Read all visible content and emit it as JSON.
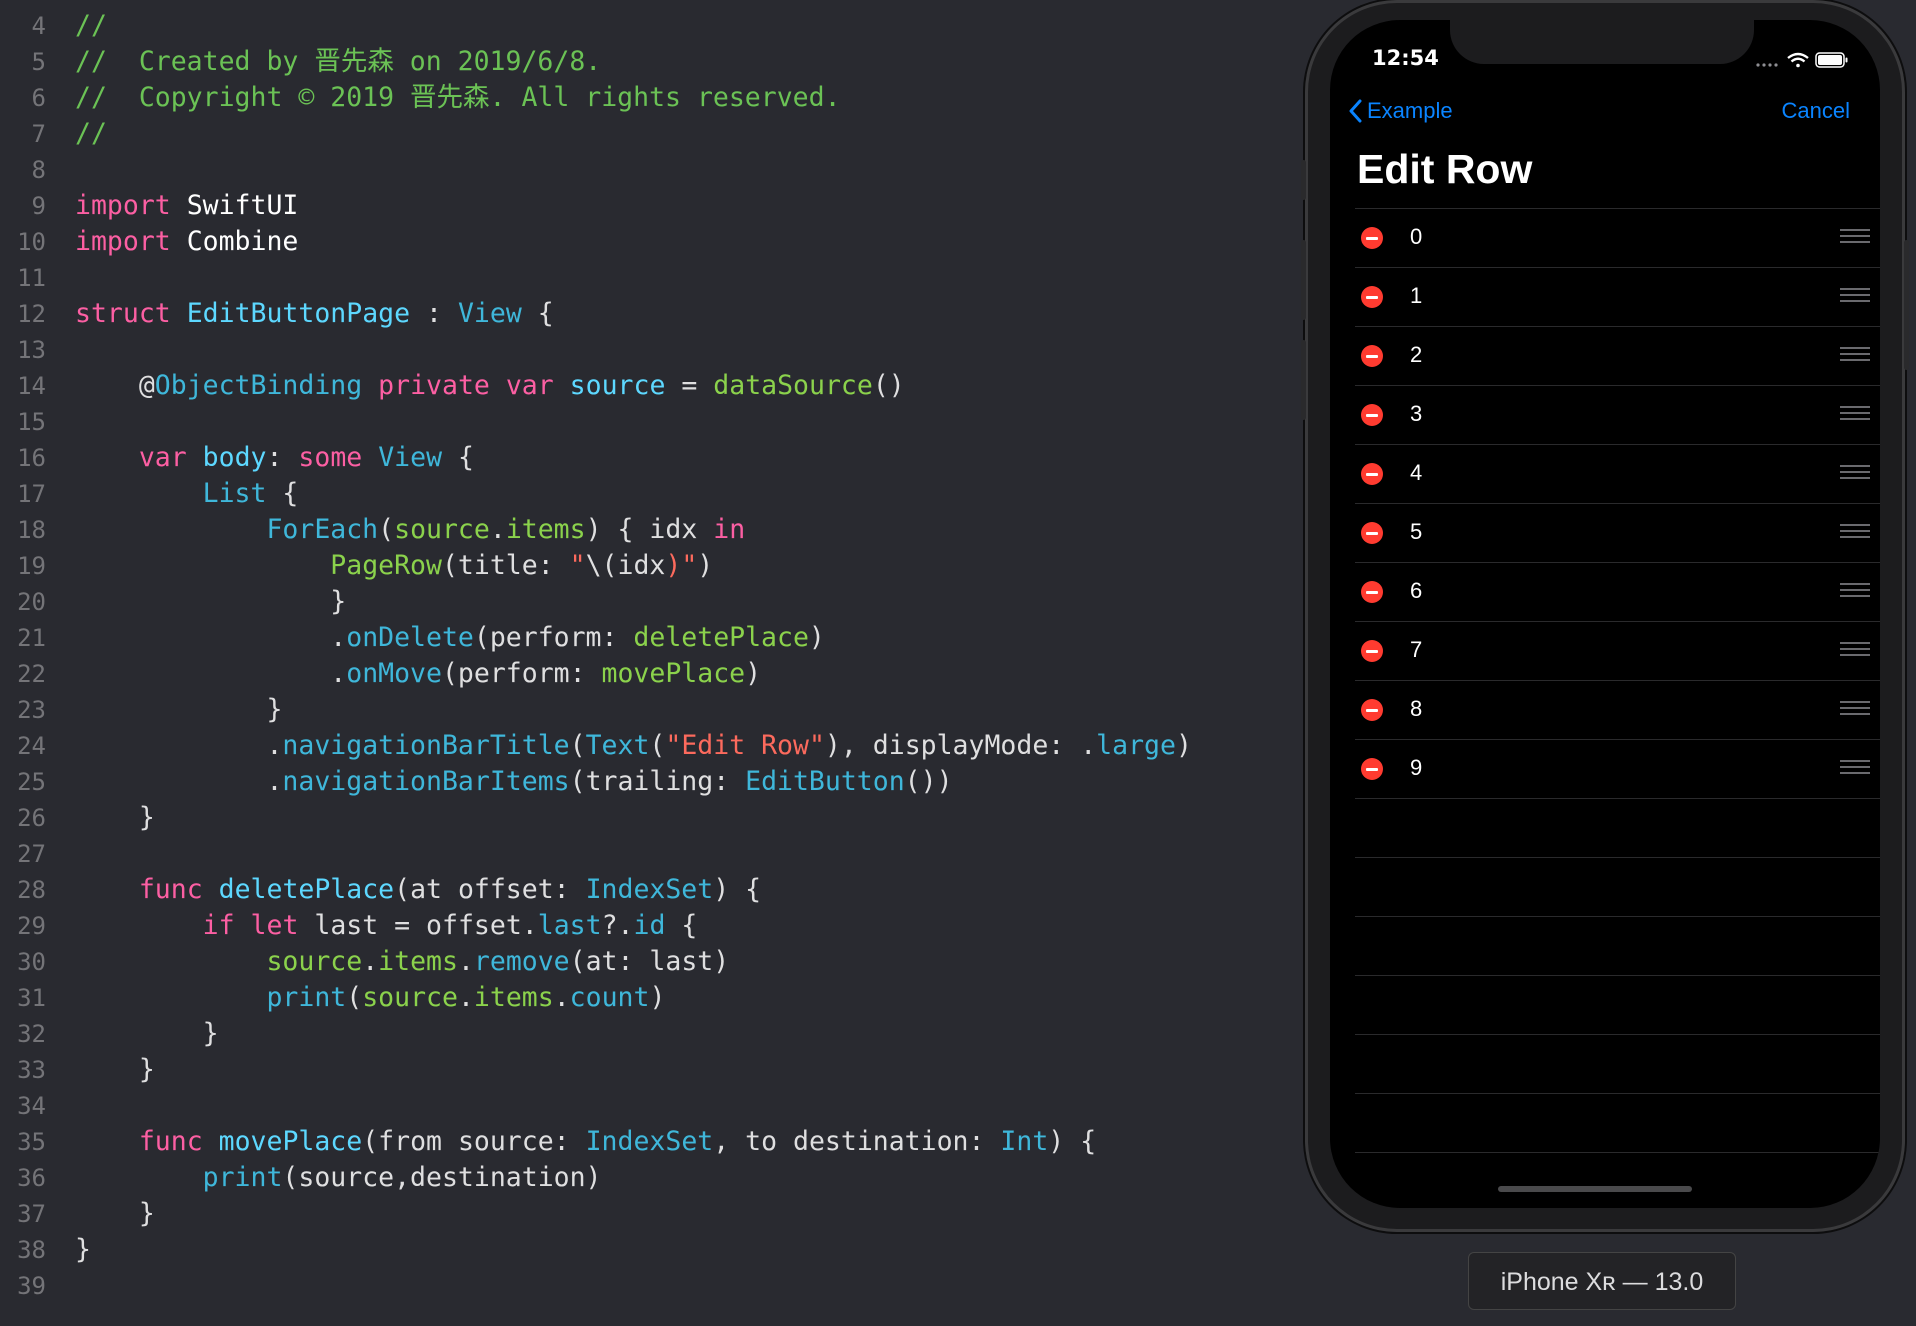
{
  "editor": {
    "lines": [
      {
        "n": "4",
        "tokens": [
          {
            "t": "//",
            "c": "t-comment"
          }
        ]
      },
      {
        "n": "5",
        "tokens": [
          {
            "t": "//  Created by 晋先森 on 2019/6/8.",
            "c": "t-comment"
          }
        ]
      },
      {
        "n": "6",
        "tokens": [
          {
            "t": "//  Copyright © 2019 晋先森. All rights reserved.",
            "c": "t-comment"
          }
        ]
      },
      {
        "n": "7",
        "tokens": [
          {
            "t": "//",
            "c": "t-comment"
          }
        ]
      },
      {
        "n": "8",
        "tokens": []
      },
      {
        "n": "9",
        "tokens": [
          {
            "t": "import",
            "c": "t-kw"
          },
          {
            "t": " SwiftUI",
            "c": "t-plain"
          }
        ]
      },
      {
        "n": "10",
        "tokens": [
          {
            "t": "import",
            "c": "t-kw"
          },
          {
            "t": " Combine",
            "c": "t-plain"
          }
        ]
      },
      {
        "n": "11",
        "tokens": []
      },
      {
        "n": "12",
        "tokens": [
          {
            "t": "struct",
            "c": "t-kw"
          },
          {
            "t": " ",
            "c": ""
          },
          {
            "t": "EditButtonPage",
            "c": "t-type"
          },
          {
            "t": " : ",
            "c": ""
          },
          {
            "t": "View",
            "c": "t-cyan"
          },
          {
            "t": " {",
            "c": ""
          }
        ]
      },
      {
        "n": "13",
        "tokens": []
      },
      {
        "n": "14",
        "tokens": [
          {
            "t": "    @",
            "c": ""
          },
          {
            "t": "ObjectBinding",
            "c": "t-cyan"
          },
          {
            "t": " ",
            "c": ""
          },
          {
            "t": "private",
            "c": "t-kw"
          },
          {
            "t": " ",
            "c": ""
          },
          {
            "t": "var",
            "c": "t-kw"
          },
          {
            "t": " ",
            "c": ""
          },
          {
            "t": "source",
            "c": "t-type"
          },
          {
            "t": " = ",
            "c": ""
          },
          {
            "t": "dataSource",
            "c": "t-green"
          },
          {
            "t": "()",
            "c": ""
          }
        ]
      },
      {
        "n": "15",
        "tokens": []
      },
      {
        "n": "16",
        "tokens": [
          {
            "t": "    ",
            "c": ""
          },
          {
            "t": "var",
            "c": "t-kw"
          },
          {
            "t": " ",
            "c": ""
          },
          {
            "t": "body",
            "c": "t-type"
          },
          {
            "t": ": ",
            "c": ""
          },
          {
            "t": "some",
            "c": "t-kw"
          },
          {
            "t": " ",
            "c": ""
          },
          {
            "t": "View",
            "c": "t-cyan"
          },
          {
            "t": " {",
            "c": ""
          }
        ]
      },
      {
        "n": "17",
        "tokens": [
          {
            "t": "        ",
            "c": ""
          },
          {
            "t": "List",
            "c": "t-cyan"
          },
          {
            "t": " {",
            "c": ""
          }
        ]
      },
      {
        "n": "18",
        "tokens": [
          {
            "t": "            ",
            "c": ""
          },
          {
            "t": "ForEach",
            "c": "t-cyan"
          },
          {
            "t": "(",
            "c": ""
          },
          {
            "t": "source",
            "c": "t-green"
          },
          {
            "t": ".",
            "c": ""
          },
          {
            "t": "items",
            "c": "t-green"
          },
          {
            "t": ") { idx ",
            "c": ""
          },
          {
            "t": "in",
            "c": "t-kw"
          }
        ]
      },
      {
        "n": "19",
        "tokens": [
          {
            "t": "                ",
            "c": ""
          },
          {
            "t": "PageRow",
            "c": "t-green"
          },
          {
            "t": "(title: ",
            "c": ""
          },
          {
            "t": "\"",
            "c": "t-str"
          },
          {
            "t": "\\(idx",
            "c": ""
          },
          {
            "t": ")\"",
            "c": "t-str"
          },
          {
            "t": ")",
            "c": ""
          }
        ]
      },
      {
        "n": "20",
        "tokens": [
          {
            "t": "                }",
            "c": ""
          }
        ]
      },
      {
        "n": "21",
        "tokens": [
          {
            "t": "                .",
            "c": ""
          },
          {
            "t": "onDelete",
            "c": "t-cyan"
          },
          {
            "t": "(perform: ",
            "c": ""
          },
          {
            "t": "deletePlace",
            "c": "t-green"
          },
          {
            "t": ")",
            "c": ""
          }
        ]
      },
      {
        "n": "22",
        "tokens": [
          {
            "t": "                .",
            "c": ""
          },
          {
            "t": "onMove",
            "c": "t-cyan"
          },
          {
            "t": "(perform: ",
            "c": ""
          },
          {
            "t": "movePlace",
            "c": "t-green"
          },
          {
            "t": ")",
            "c": ""
          }
        ]
      },
      {
        "n": "23",
        "tokens": [
          {
            "t": "            }",
            "c": ""
          }
        ]
      },
      {
        "n": "24",
        "tokens": [
          {
            "t": "            .",
            "c": ""
          },
          {
            "t": "navigationBarTitle",
            "c": "t-cyan"
          },
          {
            "t": "(",
            "c": ""
          },
          {
            "t": "Text",
            "c": "t-cyan"
          },
          {
            "t": "(",
            "c": ""
          },
          {
            "t": "\"Edit Row\"",
            "c": "t-str"
          },
          {
            "t": "), displayMode: .",
            "c": ""
          },
          {
            "t": "large",
            "c": "t-cyan"
          },
          {
            "t": ")",
            "c": ""
          }
        ]
      },
      {
        "n": "25",
        "tokens": [
          {
            "t": "            .",
            "c": ""
          },
          {
            "t": "navigationBarItems",
            "c": "t-cyan"
          },
          {
            "t": "(trailing: ",
            "c": ""
          },
          {
            "t": "EditButton",
            "c": "t-cyan"
          },
          {
            "t": "())",
            "c": ""
          }
        ]
      },
      {
        "n": "26",
        "tokens": [
          {
            "t": "    }",
            "c": ""
          }
        ]
      },
      {
        "n": "27",
        "tokens": []
      },
      {
        "n": "28",
        "tokens": [
          {
            "t": "    ",
            "c": ""
          },
          {
            "t": "func",
            "c": "t-kw"
          },
          {
            "t": " ",
            "c": ""
          },
          {
            "t": "deletePlace",
            "c": "t-type"
          },
          {
            "t": "(at offset: ",
            "c": ""
          },
          {
            "t": "IndexSet",
            "c": "t-cyan"
          },
          {
            "t": ") {",
            "c": ""
          }
        ]
      },
      {
        "n": "29",
        "tokens": [
          {
            "t": "        ",
            "c": ""
          },
          {
            "t": "if",
            "c": "t-kw"
          },
          {
            "t": " ",
            "c": ""
          },
          {
            "t": "let",
            "c": "t-kw"
          },
          {
            "t": " last = offset.",
            "c": ""
          },
          {
            "t": "last",
            "c": "t-cyan"
          },
          {
            "t": "?.",
            "c": ""
          },
          {
            "t": "id",
            "c": "t-cyan"
          },
          {
            "t": " {",
            "c": ""
          }
        ]
      },
      {
        "n": "30",
        "tokens": [
          {
            "t": "            ",
            "c": ""
          },
          {
            "t": "source",
            "c": "t-green"
          },
          {
            "t": ".",
            "c": ""
          },
          {
            "t": "items",
            "c": "t-green"
          },
          {
            "t": ".",
            "c": ""
          },
          {
            "t": "remove",
            "c": "t-cyan"
          },
          {
            "t": "(at: last)",
            "c": ""
          }
        ]
      },
      {
        "n": "31",
        "tokens": [
          {
            "t": "            ",
            "c": ""
          },
          {
            "t": "print",
            "c": "t-cyan"
          },
          {
            "t": "(",
            "c": ""
          },
          {
            "t": "source",
            "c": "t-green"
          },
          {
            "t": ".",
            "c": ""
          },
          {
            "t": "items",
            "c": "t-green"
          },
          {
            "t": ".",
            "c": ""
          },
          {
            "t": "count",
            "c": "t-cyan"
          },
          {
            "t": ")",
            "c": ""
          }
        ]
      },
      {
        "n": "32",
        "tokens": [
          {
            "t": "        }",
            "c": ""
          }
        ]
      },
      {
        "n": "33",
        "tokens": [
          {
            "t": "    }",
            "c": ""
          }
        ]
      },
      {
        "n": "34",
        "tokens": []
      },
      {
        "n": "35",
        "tokens": [
          {
            "t": "    ",
            "c": ""
          },
          {
            "t": "func",
            "c": "t-kw"
          },
          {
            "t": " ",
            "c": ""
          },
          {
            "t": "movePlace",
            "c": "t-type"
          },
          {
            "t": "(from source: ",
            "c": ""
          },
          {
            "t": "IndexSet",
            "c": "t-cyan"
          },
          {
            "t": ", to destination: ",
            "c": ""
          },
          {
            "t": "Int",
            "c": "t-cyan"
          },
          {
            "t": ") {",
            "c": ""
          }
        ]
      },
      {
        "n": "36",
        "tokens": [
          {
            "t": "        ",
            "c": ""
          },
          {
            "t": "print",
            "c": "t-cyan"
          },
          {
            "t": "(source,destination)",
            "c": ""
          }
        ]
      },
      {
        "n": "37",
        "tokens": [
          {
            "t": "    }",
            "c": ""
          }
        ]
      },
      {
        "n": "38",
        "tokens": [
          {
            "t": "}",
            "c": ""
          }
        ]
      },
      {
        "n": "39",
        "tokens": []
      }
    ]
  },
  "simulator": {
    "status_time": "12:54",
    "nav": {
      "back_label": "Example",
      "right_label": "Cancel"
    },
    "title": "Edit Row",
    "rows": [
      "0",
      "1",
      "2",
      "3",
      "4",
      "5",
      "6",
      "7",
      "8",
      "9"
    ],
    "device_label": "iPhone Xʀ — 13.0"
  },
  "colors": {
    "accent": "#0a84ff",
    "delete": "#ff3b30",
    "editor_bg": "#292a30"
  }
}
